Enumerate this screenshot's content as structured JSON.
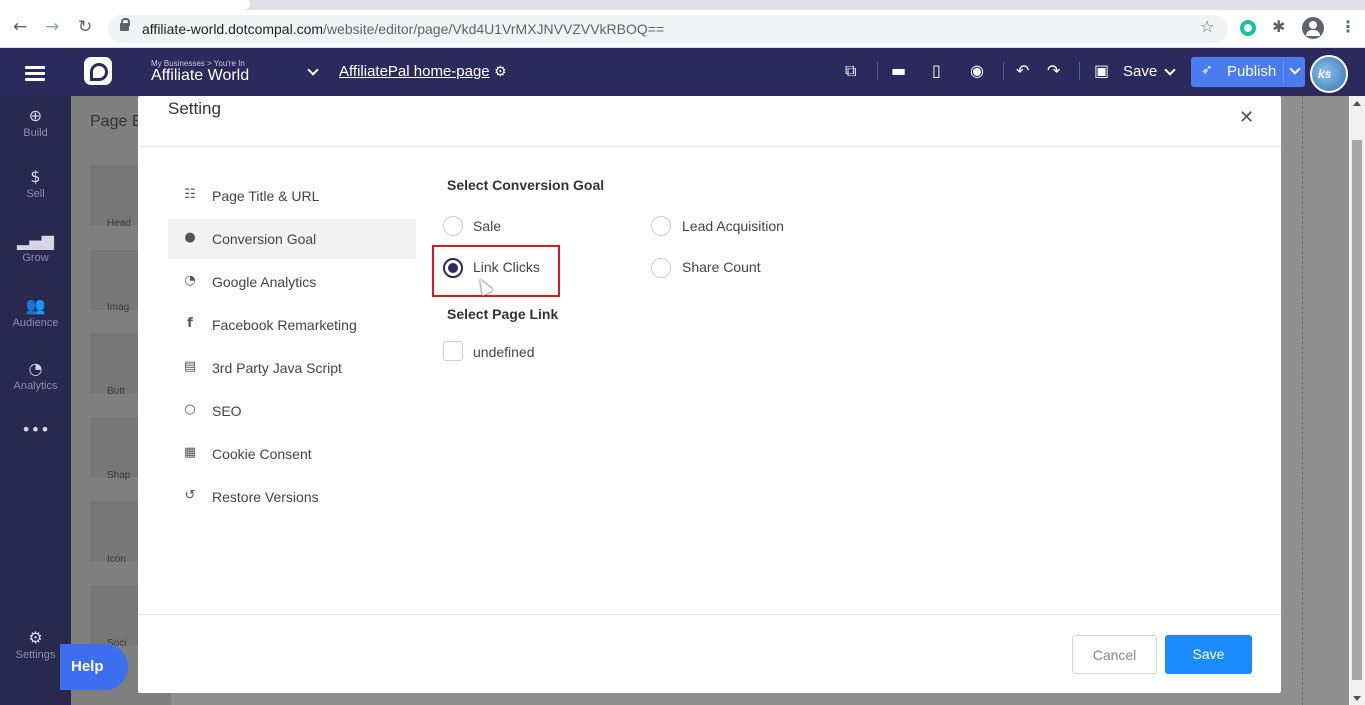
{
  "browser": {
    "back_icon": "arrow-left-icon",
    "forward_icon": "arrow-right-icon",
    "reload_icon": "reload-icon",
    "url_host": "affiliate-world.dotcompal.com",
    "url_path": "/website/editor/page/Vkd4U1VrMXJNVVZVVkRBOQ=="
  },
  "header": {
    "business_caption": "My Businesses > You're In",
    "business_name": "Affiliate World",
    "page_name": "AffiliatePal home-page",
    "save_label": "Save",
    "publish_label": "Publish",
    "avatar_text": "ks"
  },
  "sidebar": {
    "items": [
      {
        "icon": "plus-circle-icon",
        "label": "Build"
      },
      {
        "icon": "dollar-icon",
        "label": "Sell"
      },
      {
        "icon": "bar-chart-icon",
        "label": "Grow"
      },
      {
        "icon": "users-icon",
        "label": "Audience"
      },
      {
        "icon": "analytics-icon",
        "label": "Analytics"
      },
      {
        "icon": "more-icon",
        "label": ""
      }
    ],
    "settings_label": "Settings",
    "help_label": "Help"
  },
  "background": {
    "panel_title": "Page E",
    "tiles": [
      "Head",
      "Imag",
      "Butt",
      "Shap",
      "Icon",
      "Soci"
    ]
  },
  "modal": {
    "title": "Setting",
    "menu": [
      {
        "icon": "list-icon",
        "label": "Page Title & URL"
      },
      {
        "icon": "target-icon",
        "label": "Conversion Goal"
      },
      {
        "icon": "google-analytics-icon",
        "label": "Google Analytics"
      },
      {
        "icon": "facebook-icon",
        "label": "Facebook Remarketing"
      },
      {
        "icon": "script-icon",
        "label": "3rd Party Java Script"
      },
      {
        "icon": "search-icon",
        "label": "SEO"
      },
      {
        "icon": "cookie-icon",
        "label": "Cookie Consent"
      },
      {
        "icon": "restore-icon",
        "label": "Restore Versions"
      }
    ],
    "active_menu_index": 1,
    "conversion_goal_heading": "Select Conversion Goal",
    "goals": [
      {
        "label": "Sale",
        "checked": false
      },
      {
        "label": "Lead Acquisition",
        "checked": false
      },
      {
        "label": "Link Clicks",
        "checked": true
      },
      {
        "label": "Share Count",
        "checked": false
      }
    ],
    "page_link_heading": "Select Page Link",
    "page_link_option": "undefined",
    "cancel_label": "Cancel",
    "save_label": "Save"
  },
  "colors": {
    "header_bg": "#2c2a5c",
    "sidebar_bg": "#29284f",
    "publish_bg": "#4a7cf0",
    "save_button_bg": "#1a8cff",
    "highlight_border": "#e0141e"
  }
}
